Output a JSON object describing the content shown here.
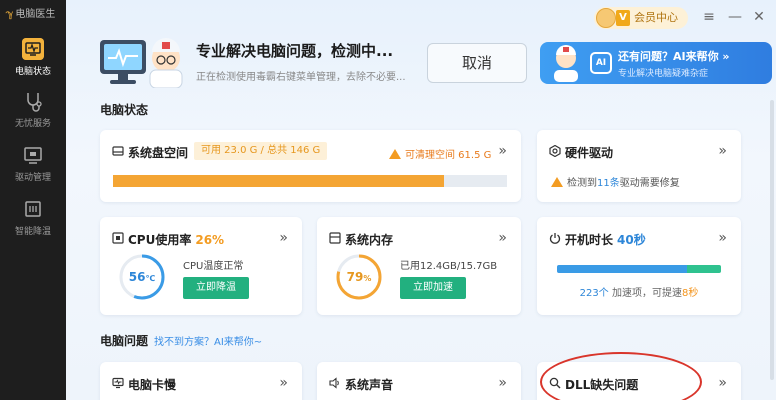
{
  "app": {
    "title": "电脑医生"
  },
  "sidebar": {
    "items": [
      {
        "label": "电脑状态",
        "icon": "pulse-monitor-icon",
        "active": true
      },
      {
        "label": "无忧服务",
        "icon": "stethoscope-icon",
        "active": false
      },
      {
        "label": "驱动管理",
        "icon": "driver-chip-icon",
        "active": false
      },
      {
        "label": "智能降温",
        "icon": "cooling-chip-icon",
        "active": false
      }
    ]
  },
  "topbar": {
    "member_label": "会员中心",
    "vip_badge": "V",
    "menu_icon": "≡",
    "min_icon": "—",
    "close_icon": "✕"
  },
  "hero": {
    "title": "专业解决电脑问题，检测中...",
    "subtitle": "正在检测使用毒霸右键菜单管理，去除不必要...",
    "cancel_label": "取消"
  },
  "ai_banner": {
    "title": "还有问题？AI来帮你 »",
    "subtitle": "专业解决电脑疑难杂症",
    "badge": "AI"
  },
  "status_section": {
    "title": "电脑状态"
  },
  "disk": {
    "title": "系统盘空间",
    "usage": "可用 23.0 G / 总共 146 G",
    "cleanable": "可清理空间 61.5 G",
    "fill_fraction": 0.84
  },
  "hardware": {
    "title": "硬件驱动",
    "prefix": "检测到",
    "count": "11条",
    "suffix": "驱动需要修复"
  },
  "cpu": {
    "title": "CPU使用率",
    "percent": "26%",
    "gauge_value": "56",
    "gauge_unit": "℃",
    "gauge_fraction": 0.56,
    "status": "CPU温度正常",
    "button": "立即降温"
  },
  "memory": {
    "title": "系统内存",
    "gauge_value": "79",
    "gauge_unit": "%",
    "gauge_fraction": 0.79,
    "status": "已用12.4GB/15.7GB",
    "button": "立即加速"
  },
  "boot": {
    "title": "开机时长",
    "duration": "40秒",
    "blue_fraction": 0.79,
    "green_fraction": 0.21,
    "items_count": "223个",
    "items_label": "加速项，可提速",
    "speedup": "8秒"
  },
  "problems_section": {
    "title": "电脑问题",
    "link": "找不到方案？AI来帮你~"
  },
  "problems": [
    {
      "title": "电脑卡慢",
      "icon": "monitor-pulse-icon"
    },
    {
      "title": "系统声音",
      "icon": "speaker-icon"
    },
    {
      "title": "DLL缺失问题",
      "icon": "search-icon"
    }
  ],
  "chevron": "»",
  "colors": {
    "accent_orange": "#f4a534",
    "accent_green": "#22b07f",
    "accent_blue": "#3a9be6",
    "sidebar_bg": "#1e1e1e",
    "highlight_red": "#d9352b"
  }
}
